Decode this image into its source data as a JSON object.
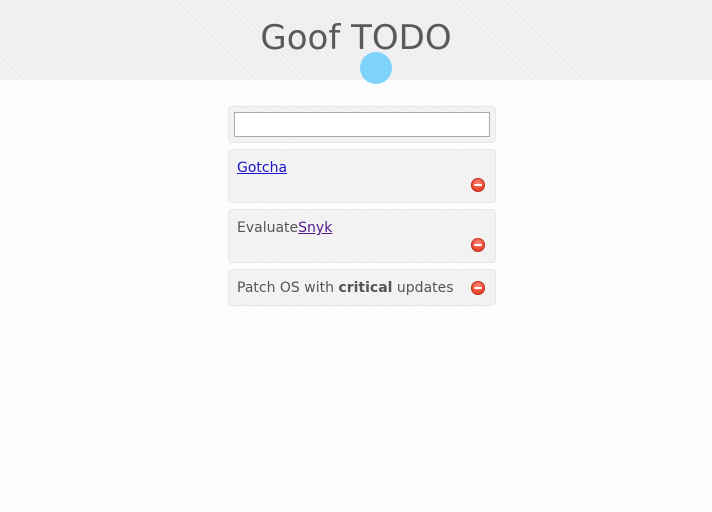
{
  "app": {
    "title": "Goof TODO"
  },
  "new_todo": {
    "value": "",
    "placeholder": ""
  },
  "todos": [
    {
      "link_text": "Gotcha"
    },
    {
      "text": "Evaluate",
      "link_text": "Snyk"
    },
    {
      "text_before": "Patch OS with ",
      "bold_text": "critical",
      "text_after": " updates"
    }
  ],
  "icons": {
    "remove": "remove-circle-icon"
  },
  "colors": {
    "link": "#1a14c8",
    "visited_link": "#551a8b",
    "remove_button": "#e8442c",
    "cursor_indicator": "#7fd2fb"
  }
}
